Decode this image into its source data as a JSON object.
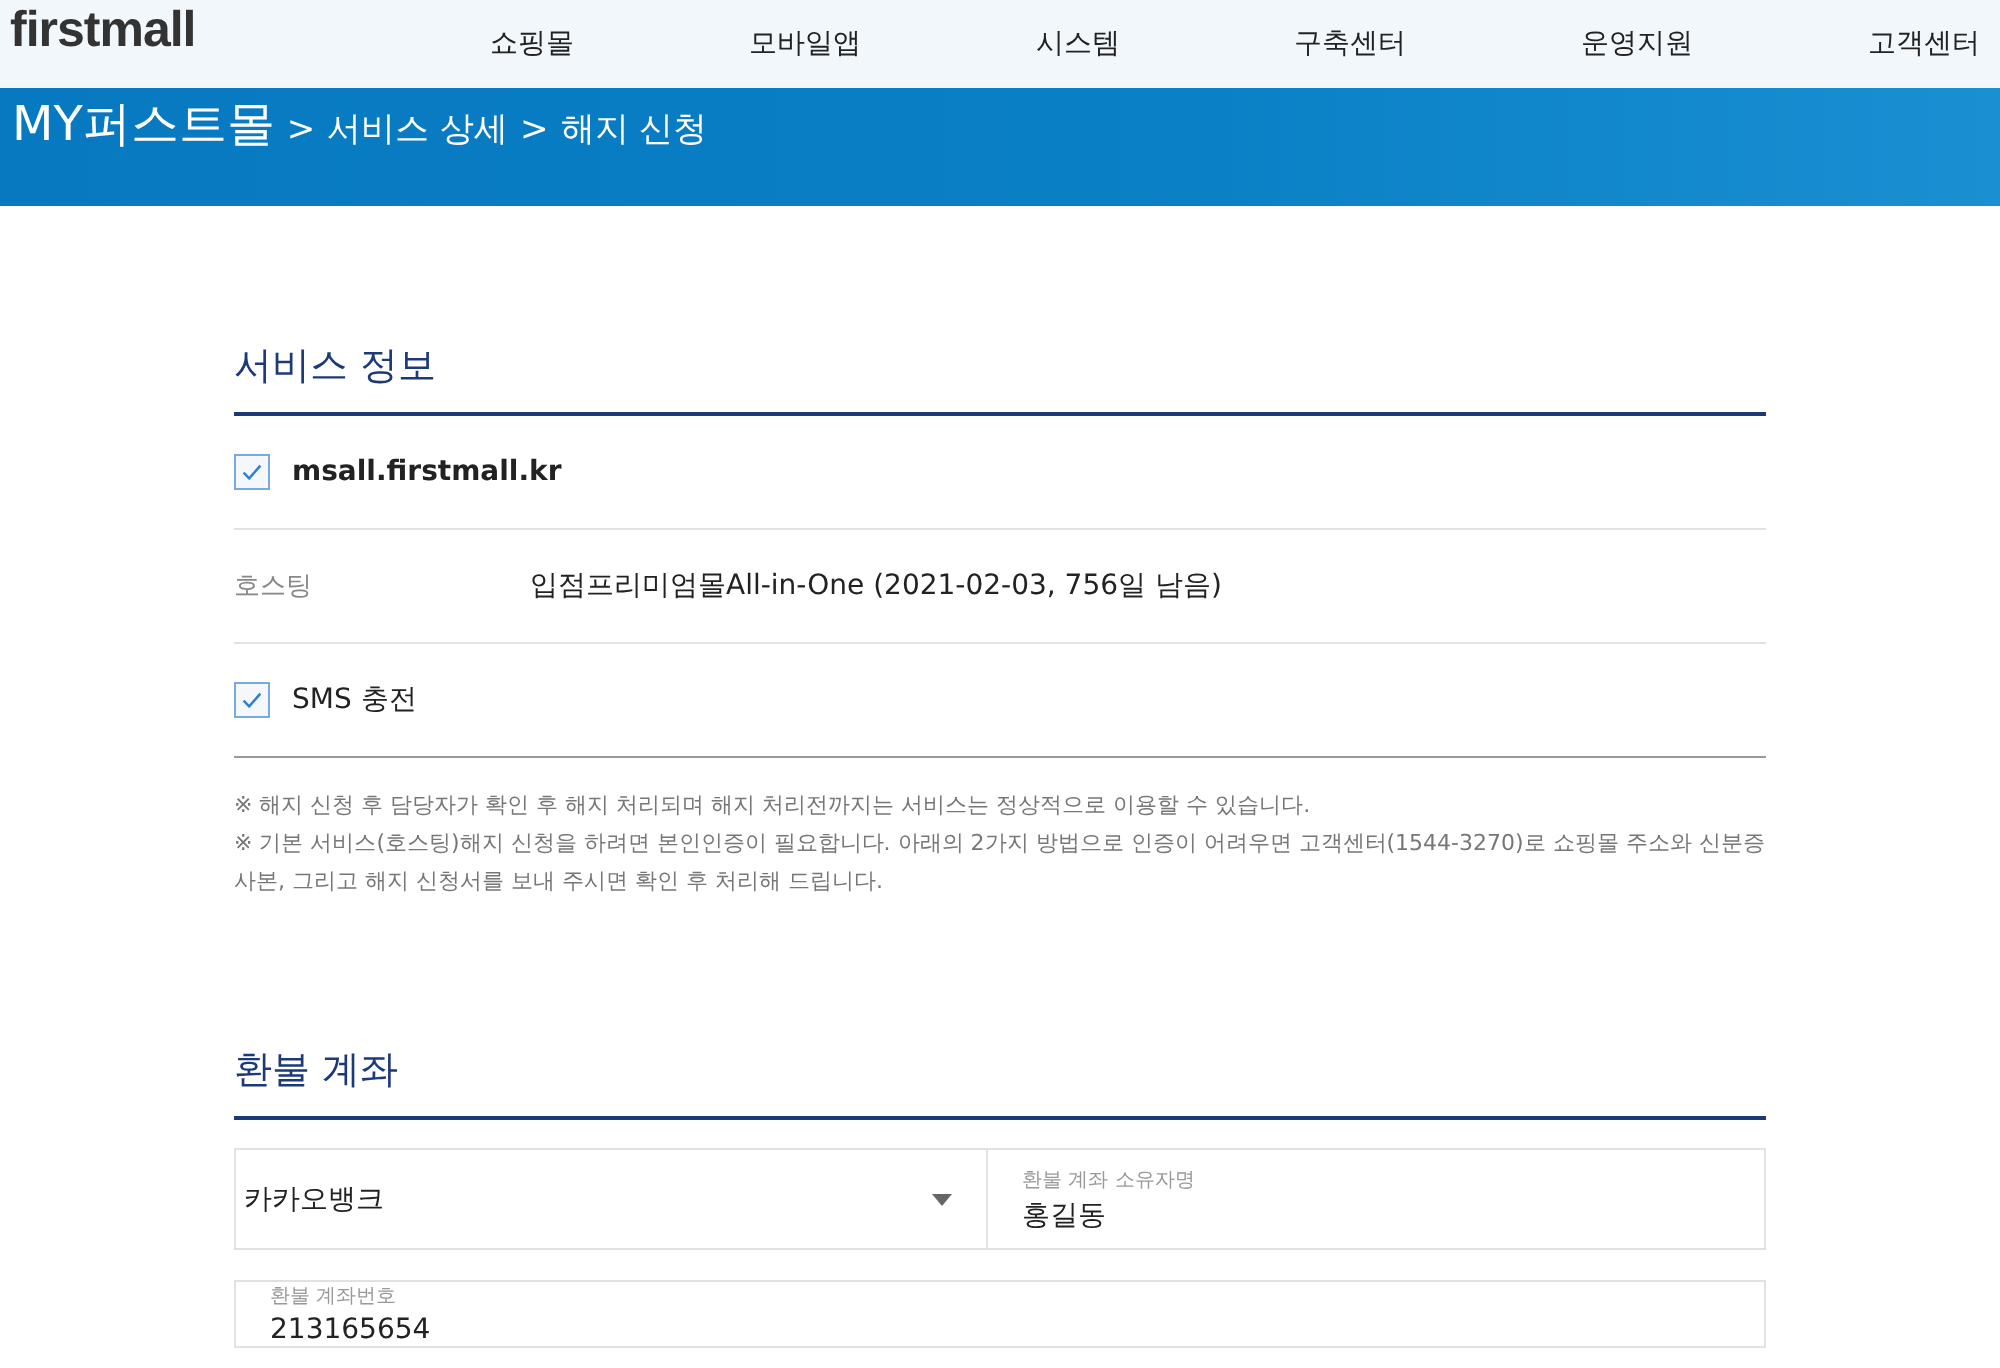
{
  "header": {
    "logo": "firstmall",
    "nav": [
      "쇼핑몰",
      "모바일앱",
      "시스템",
      "구축센터",
      "운영지원",
      "고객센터"
    ]
  },
  "breadcrumb": {
    "root": "MY퍼스트몰",
    "items": [
      "서비스 상세",
      "해지 신청"
    ],
    "separator": ">"
  },
  "service_info": {
    "title": "서비스 정보",
    "rows": [
      {
        "kind": "check",
        "label": "msall.firstmall.kr",
        "checked": true,
        "bold": true
      },
      {
        "kind": "info",
        "label": "호스팅",
        "value": "입점프리미엄몰All-in-One (2021-02-03, 756일 남음)"
      },
      {
        "kind": "check",
        "label": "SMS 충전",
        "checked": true,
        "bold": false
      }
    ],
    "notes": [
      "※ 해지 신청 후 담당자가 확인 후 해지 처리되며 해지 처리전까지는 서비스는 정상적으로 이용할 수 있습니다.",
      "※ 기본 서비스(호스팅)해지 신청을 하려면 본인인증이 필요합니다. 아래의 2가지 방법으로 인증이 어려우면 고객센터(1544-3270)로 쇼핑몰 주소와 신분증 사본, 그리고 해지 신청서를 보내 주시면 확인 후 처리해 드립니다."
    ]
  },
  "refund_account": {
    "title": "환불 계좌",
    "bank": {
      "value": "카카오뱅크"
    },
    "holder": {
      "label": "환불 계좌 소유자명",
      "value": "홍길동"
    },
    "number": {
      "label": "환불 계좌번호",
      "value": "213165654"
    }
  }
}
